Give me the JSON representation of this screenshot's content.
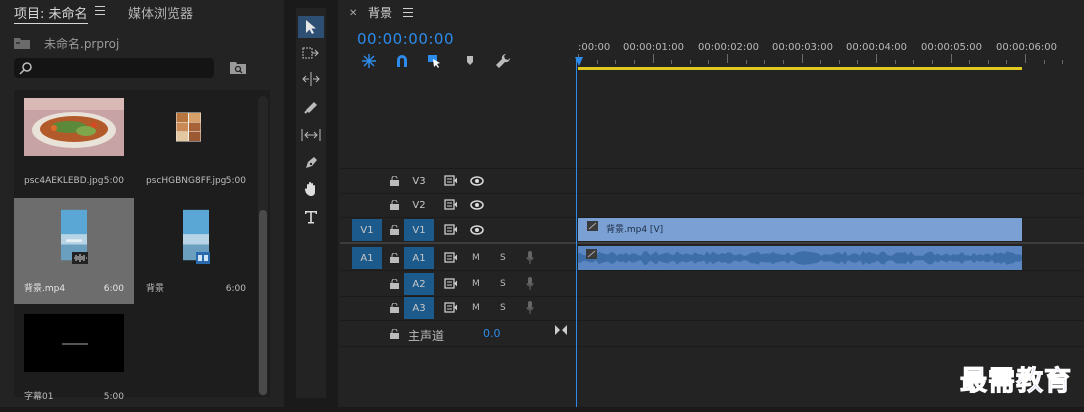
{
  "project_panel": {
    "tabs": [
      {
        "label": "项目: 未命名",
        "active": true
      },
      {
        "label": "媒体浏览器",
        "active": false
      }
    ],
    "project_file": "未命名.prproj",
    "search": {
      "value": "",
      "placeholder": ""
    },
    "items": [
      {
        "name": "psc4AEKLEBD.jpg",
        "duration": "5:00",
        "kind": "image-food",
        "selected": false
      },
      {
        "name": "pscHGBNG8FF.jpg",
        "duration": "5:00",
        "kind": "image-collage",
        "selected": false
      },
      {
        "name": "背景.mp4",
        "duration": "6:00",
        "kind": "video",
        "selected": true
      },
      {
        "name": "背景",
        "duration": "6:00",
        "kind": "sequence",
        "selected": false
      },
      {
        "name": "字幕01",
        "duration": "5:00",
        "kind": "title",
        "selected": false
      }
    ]
  },
  "tools": [
    "selection-tool",
    "track-select-tool",
    "ripple-edit-tool",
    "razor-tool",
    "slip-tool",
    "pen-tool",
    "hand-tool",
    "type-tool"
  ],
  "timeline": {
    "sequence_name": "背景",
    "timecode": "00:00:00:00",
    "ruler": [
      ":00:00",
      "00:00:01:00",
      "00:00:02:00",
      "00:00:03:00",
      "00:00:04:00",
      "00:00:05:00",
      "00:00:06:00"
    ],
    "video_tracks": [
      {
        "source": "",
        "name": "V3"
      },
      {
        "source": "",
        "name": "V2"
      },
      {
        "source": "V1",
        "name": "V1"
      }
    ],
    "audio_tracks": [
      {
        "source": "A1",
        "name": "A1",
        "m": "M",
        "s": "S"
      },
      {
        "source": "",
        "name": "A2",
        "m": "M",
        "s": "S"
      },
      {
        "source": "",
        "name": "A3",
        "m": "M",
        "s": "S"
      }
    ],
    "master": {
      "label": "主声道",
      "value": "0.0"
    },
    "video_clip": {
      "label": "背景.mp4 [V]"
    }
  },
  "watermark": "最需教育",
  "colors": {
    "accent": "#2d8ceb",
    "track_on": "#1c5a8c",
    "clip_video": "#7aa0d4",
    "clip_audio": "#5c87c2",
    "work_area": "#e0c91e"
  }
}
